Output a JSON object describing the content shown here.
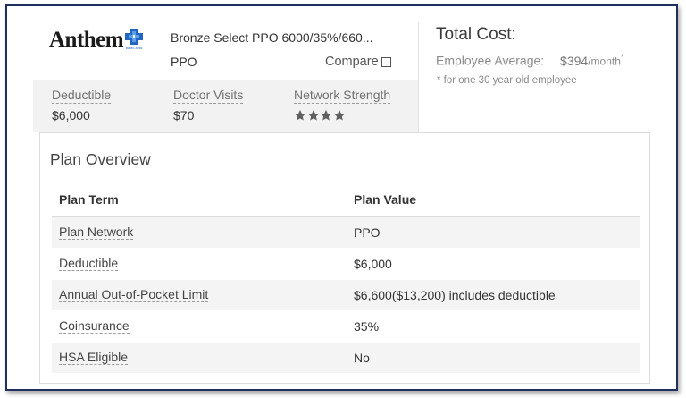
{
  "brand": {
    "logo_text": "Anthem",
    "logo_subtext": "BlueCross"
  },
  "plan": {
    "name": "Bronze Select PPO 6000/35%/660...",
    "type": "PPO",
    "compare_label": "Compare"
  },
  "stats": {
    "deductible_label": "Deductible",
    "deductible_value": "$6,000",
    "doctor_visits_label": "Doctor Visits",
    "doctor_visits_value": "$70",
    "network_strength_label": "Network Strength",
    "network_strength_stars": 4,
    "network_strength_max": 4
  },
  "total_cost": {
    "title": "Total Cost:",
    "employee_average_label": "Employee Average:",
    "price": "$394",
    "unit": "/month",
    "asterisk": "*",
    "footnote": "* for one 30 year old employee"
  },
  "overview": {
    "title": "Plan Overview",
    "col_term": "Plan Term",
    "col_value": "Plan Value",
    "rows": [
      {
        "term": "Plan Network",
        "value": "PPO"
      },
      {
        "term": "Deductible",
        "value": "$6,000"
      },
      {
        "term": "Annual Out-of-Pocket Limit",
        "value": "$6,600($13,200) includes deductible"
      },
      {
        "term": "Coinsurance",
        "value": "35%"
      },
      {
        "term": "HSA Eligible",
        "value": "No"
      }
    ]
  },
  "colors": {
    "frame_border": "#1f2f5e",
    "brand_blue": "#2366c2",
    "stats_bg": "#f2f2f2",
    "star": "#5f5f5f"
  },
  "icons": {
    "logo_mark": "blue-cross-shield-icon",
    "checkbox": "checkbox-icon",
    "rating": "star-icon"
  }
}
